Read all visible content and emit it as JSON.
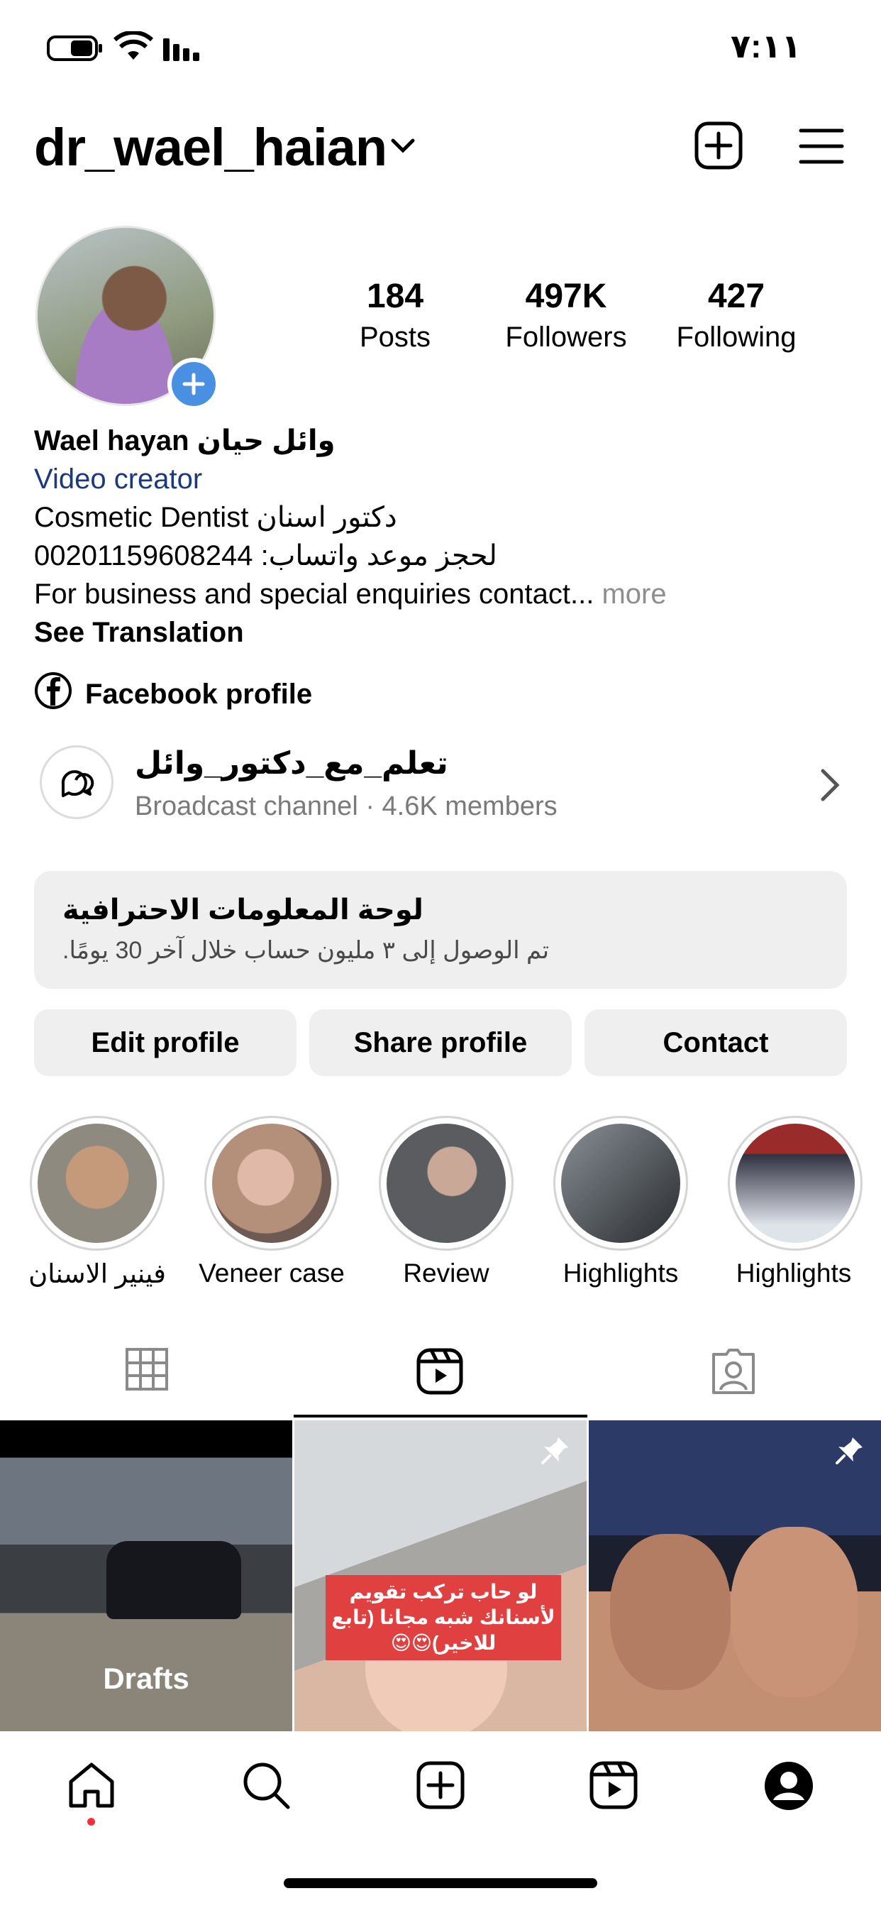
{
  "status_bar": {
    "time": "٧:١١"
  },
  "header": {
    "username": "dr_wael_haian"
  },
  "stats": [
    {
      "value": "184",
      "label": "Posts"
    },
    {
      "value": "497K",
      "label": "Followers"
    },
    {
      "value": "427",
      "label": "Following"
    }
  ],
  "bio": {
    "name": "Wael hayan وائل حيان",
    "category": "Video creator",
    "line1": "Cosmetic Dentist دكتور اسنان",
    "line2": "لحجز موعد واتساب: 00201159608244",
    "line3": "For business and special enquiries contact...",
    "more": "more",
    "see_translation": "See Translation"
  },
  "link": {
    "label": "Facebook profile"
  },
  "broadcast": {
    "title": "تعلم_مع_دكتور_وائل",
    "subtitle": "Broadcast channel · 4.6K members"
  },
  "dashboard": {
    "title": "لوحة المعلومات الاحترافية",
    "subtitle": "تم الوصول إلى ٣ مليون حساب خلال آخر 30 يومًا."
  },
  "buttons": {
    "edit": "Edit profile",
    "share": "Share profile",
    "contact": "Contact"
  },
  "highlights": [
    {
      "label": "فينير الاسنان",
      "color": "#8f8a80"
    },
    {
      "label": "Veneer case",
      "color": "#b48f7a"
    },
    {
      "label": "Review",
      "color": "#5a5c60"
    },
    {
      "label": "Highlights",
      "color": "#4e5358"
    },
    {
      "label": "Highlights",
      "color": "#2f3140"
    }
  ],
  "grid": {
    "drafts_label": "Drafts",
    "reel_caption": "لو حاب تركب تقويم لأسنانك شبه مجانا (تابع للاخير)😍😍"
  },
  "colors": {
    "accent_blue": "#4a90e2",
    "link_blue": "#1a3a7c",
    "notification_red": "#ff2d3b"
  }
}
